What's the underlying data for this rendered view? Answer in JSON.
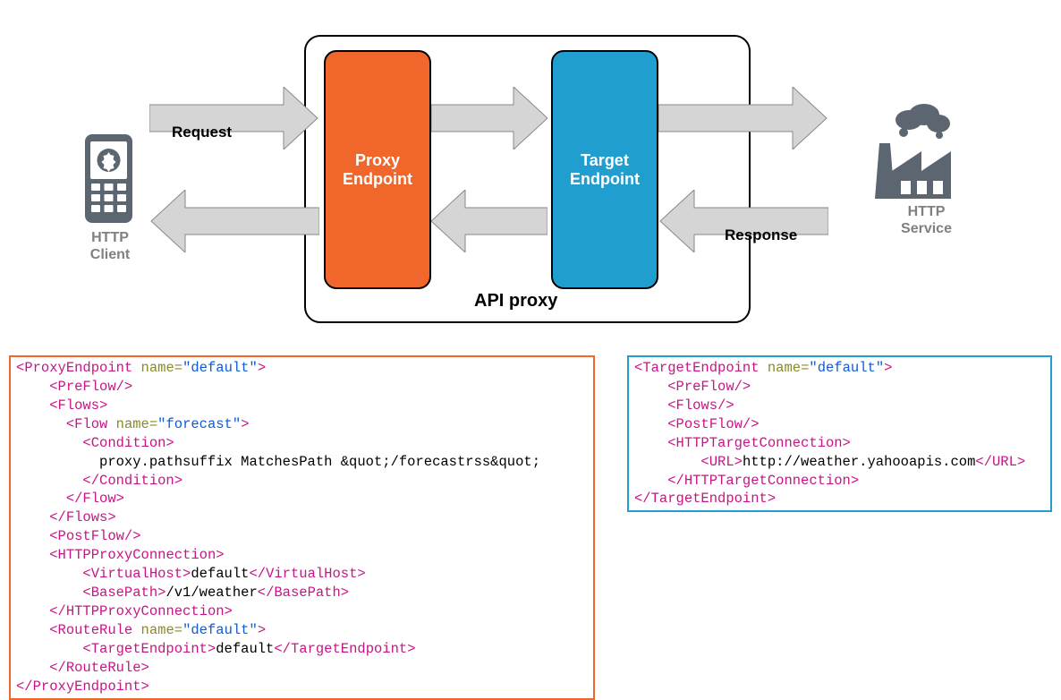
{
  "labels": {
    "client": "HTTP\nClient",
    "service": "HTTP\nService",
    "request": "Request",
    "response": "Response",
    "api_proxy": "API proxy",
    "proxy_endpoint": "Proxy\nEndpoint",
    "target_endpoint": "Target\nEndpoint"
  },
  "colors": {
    "proxy": "#f1662a",
    "target": "#219ed0",
    "arrow": "#d5d5d5",
    "iconGrey": "#5c6670"
  },
  "proxy_xml": {
    "root_name": "ProxyEndpoint",
    "root_attr": "default",
    "flow_name": "forecast",
    "condition": "proxy.pathsuffix MatchesPath &quot;/forecastrss&quot;",
    "virtual_host": "default",
    "base_path": "/v1/weather",
    "route_rule_name": "default",
    "route_target": "default"
  },
  "target_xml": {
    "root_name": "TargetEndpoint",
    "root_attr": "default",
    "url": "http://weather.yahooapis.com"
  }
}
